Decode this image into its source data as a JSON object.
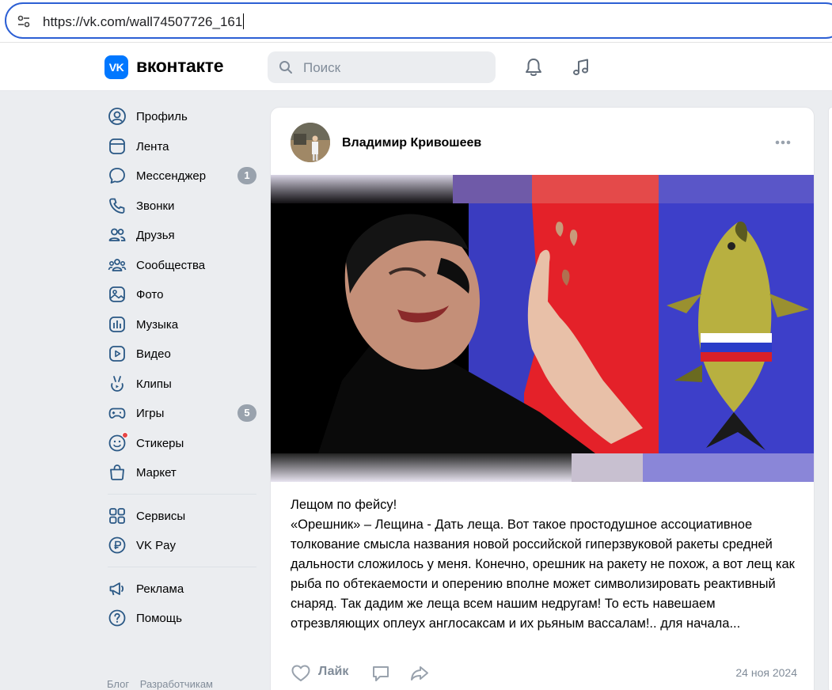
{
  "browser": {
    "url": "https://vk.com/wall74507726_161"
  },
  "header": {
    "logo_text": "VK",
    "brand": "вконтакте",
    "search_placeholder": "Поиск",
    "icons": [
      "bell-icon",
      "music-note-icon"
    ]
  },
  "sidebar": {
    "items": [
      {
        "label": "Профиль",
        "icon": "profile-icon"
      },
      {
        "label": "Лента",
        "icon": "feed-icon"
      },
      {
        "label": "Мессенджер",
        "icon": "messenger-icon",
        "badge": "1"
      },
      {
        "label": "Звонки",
        "icon": "phone-icon"
      },
      {
        "label": "Друзья",
        "icon": "friends-icon"
      },
      {
        "label": "Сообщества",
        "icon": "communities-icon"
      },
      {
        "label": "Фото",
        "icon": "photo-icon"
      },
      {
        "label": "Музыка",
        "icon": "music-icon"
      },
      {
        "label": "Видео",
        "icon": "video-icon"
      },
      {
        "label": "Клипы",
        "icon": "clips-icon"
      },
      {
        "label": "Игры",
        "icon": "games-icon",
        "badge": "5"
      },
      {
        "label": "Стикеры",
        "icon": "stickers-icon"
      },
      {
        "label": "Маркет",
        "icon": "market-icon"
      }
    ],
    "items2": [
      {
        "label": "Сервисы",
        "icon": "services-icon"
      },
      {
        "label": "VK Pay",
        "icon": "vkpay-icon"
      }
    ],
    "items3": [
      {
        "label": "Реклама",
        "icon": "ads-icon"
      },
      {
        "label": "Помощь",
        "icon": "help-icon"
      }
    ],
    "footer": [
      "Блог",
      "Разработчикам"
    ]
  },
  "post": {
    "author": "Владимир Кривошеев",
    "text_title": "Лещом по фейсу!",
    "text_body": "«Орешник» – Лещина - Дать леща. Вот такое простодушное ассоциативное толкование смысла названия новой российской гиперзвуковой ракеты средней дальности сложилось у меня. Конечно, орешник на ракету не похож, а вот лещ как рыба по обтекаемости и оперению вполне может символизировать реактивный снаряд. Так дадим же леща всем нашим недругам! То есть навешаем отрезвляющих оплеух англосаксам и их рьяным вассалам!.. для начала...",
    "like_label": "Лайк",
    "date": "24 ноя 2024"
  }
}
